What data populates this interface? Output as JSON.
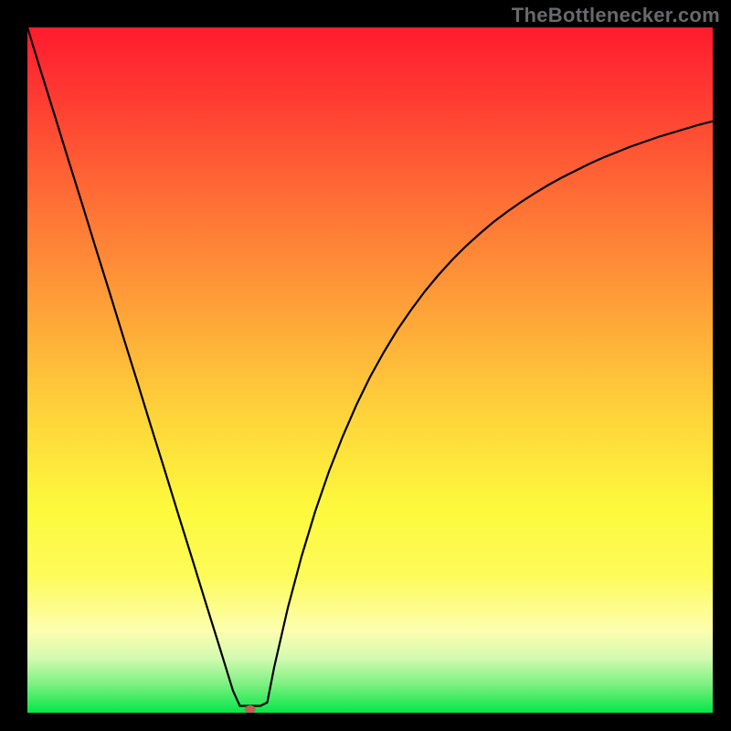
{
  "watermark": "TheBottlenecker.com",
  "chart_data": {
    "type": "line",
    "title": "",
    "xlabel": "",
    "ylabel": "",
    "xlim": [
      0,
      100
    ],
    "ylim": [
      0,
      100
    ],
    "x": [
      0,
      2,
      4,
      6,
      8,
      10,
      12,
      14,
      16,
      18,
      20,
      22,
      24,
      26,
      28,
      30,
      31,
      32,
      33,
      34,
      35,
      36,
      38,
      40,
      42,
      44,
      46,
      48,
      50,
      52,
      54,
      56,
      58,
      60,
      62,
      64,
      66,
      68,
      70,
      72,
      74,
      76,
      78,
      80,
      82,
      84,
      86,
      88,
      90,
      92,
      94,
      96,
      98,
      100
    ],
    "y": [
      100,
      93.5,
      87.1,
      80.6,
      74.2,
      67.7,
      61.3,
      54.8,
      48.4,
      41.9,
      35.5,
      29.0,
      22.6,
      16.1,
      9.7,
      3.2,
      1.0,
      1.0,
      1.0,
      1.0,
      1.5,
      6.6,
      15.3,
      22.8,
      29.4,
      35.2,
      40.3,
      44.9,
      49.0,
      52.6,
      55.9,
      58.8,
      61.5,
      63.9,
      66.1,
      68.1,
      69.9,
      71.6,
      73.1,
      74.5,
      75.8,
      77.0,
      78.1,
      79.1,
      80.1,
      81.0,
      81.8,
      82.6,
      83.3,
      84.0,
      84.6,
      85.2,
      85.8,
      86.3
    ],
    "optimum_marker": {
      "x": 32.5,
      "y": 0.5
    },
    "gradient_stops": [
      {
        "offset": 0.0,
        "color": "#ff1b2e"
      },
      {
        "offset": 0.1,
        "color": "#ff3a32"
      },
      {
        "offset": 0.25,
        "color": "#ff6e35"
      },
      {
        "offset": 0.4,
        "color": "#fe9e38"
      },
      {
        "offset": 0.55,
        "color": "#fecf3a"
      },
      {
        "offset": 0.7,
        "color": "#fdf93c"
      },
      {
        "offset": 0.8,
        "color": "#fdfb59"
      },
      {
        "offset": 0.88,
        "color": "#fdfeaf"
      },
      {
        "offset": 0.92,
        "color": "#d3fab1"
      },
      {
        "offset": 0.96,
        "color": "#79f07f"
      },
      {
        "offset": 1.0,
        "color": "#04e648"
      }
    ]
  }
}
